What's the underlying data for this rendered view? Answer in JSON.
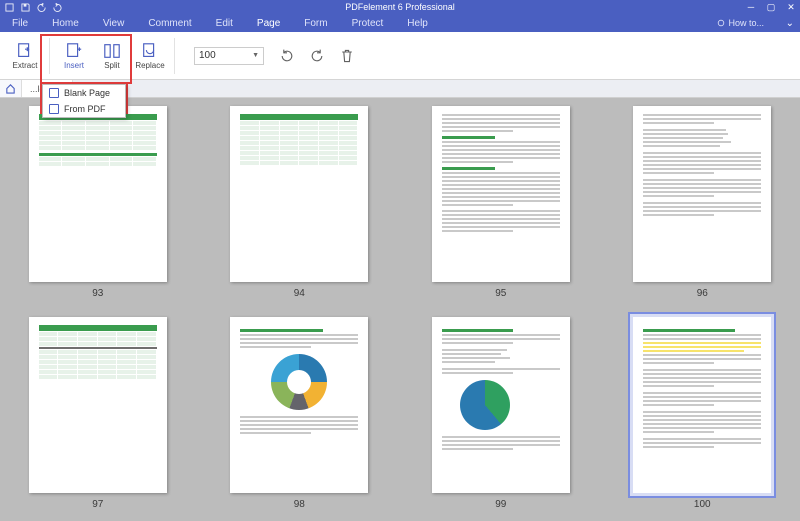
{
  "app": {
    "title": "PDFelement 6 Professional"
  },
  "menu": {
    "items": [
      "File",
      "Home",
      "View",
      "Comment",
      "Edit",
      "Page",
      "Form",
      "Protect",
      "Help"
    ],
    "active_index": 5,
    "howto": "How to..."
  },
  "ribbon": {
    "buttons": [
      {
        "label": "Extract",
        "icon": "extract-icon"
      },
      {
        "label": "Insert",
        "icon": "insert-icon",
        "active": true
      },
      {
        "label": "Split",
        "icon": "split-icon"
      },
      {
        "label": "Replace",
        "icon": "replace-icon"
      }
    ],
    "page_field": "100"
  },
  "insert_menu": {
    "items": [
      "Blank Page",
      "From PDF"
    ]
  },
  "tabs": {
    "open": [
      {
        "label": "...lget"
      }
    ]
  },
  "thumbnails": {
    "pages": [
      93,
      94,
      95,
      96,
      97,
      98,
      99,
      100
    ],
    "selected": 100
  }
}
